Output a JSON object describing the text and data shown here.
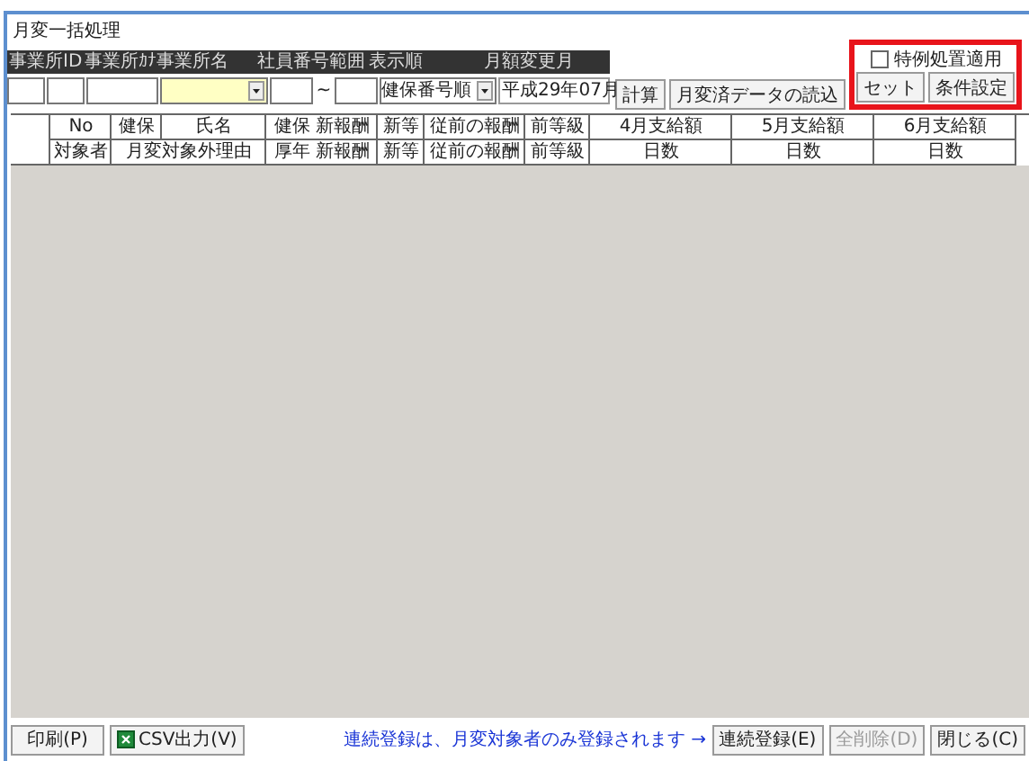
{
  "window": {
    "title": "月変一括処理"
  },
  "filter_labels": [
    "事業所ID",
    "事業所ｶﾅ",
    "事業所名",
    "社員番号範囲",
    "表示順",
    "月額変更月"
  ],
  "range_separator": "~",
  "sort_order": {
    "value": "健保番号順"
  },
  "change_month": {
    "value": "平成29年07月"
  },
  "special_measure": {
    "label": "特例処置適用",
    "checked": false
  },
  "toolbar_buttons": [
    "計算",
    "月変済データの読込",
    "セット",
    "条件設定"
  ],
  "table": {
    "header_row_1": [
      "No",
      "健保",
      "氏名",
      "健保 新報酬",
      "新等",
      "従前の報酬",
      "前等級",
      "4月支給額",
      "5月支給額",
      "6月支給額"
    ],
    "header_row_2": [
      "対象者",
      "月変対象外理由",
      "厚年 新報酬",
      "新等",
      "従前の報酬",
      "前等級",
      "日数",
      "日数",
      "日数"
    ]
  },
  "footer": {
    "buttons_left": [
      {
        "label": "印刷(P)",
        "kind": "plain"
      },
      {
        "label": "CSV出力(V)",
        "kind": "csv"
      }
    ],
    "note": "連続登録は、月変対象者のみ登録されます →",
    "buttons_right": [
      {
        "label": "連続登録(E)",
        "disabled": false
      },
      {
        "label": "全削除(D)",
        "disabled": true
      },
      {
        "label": "閉じる(C)",
        "disabled": false
      }
    ]
  }
}
